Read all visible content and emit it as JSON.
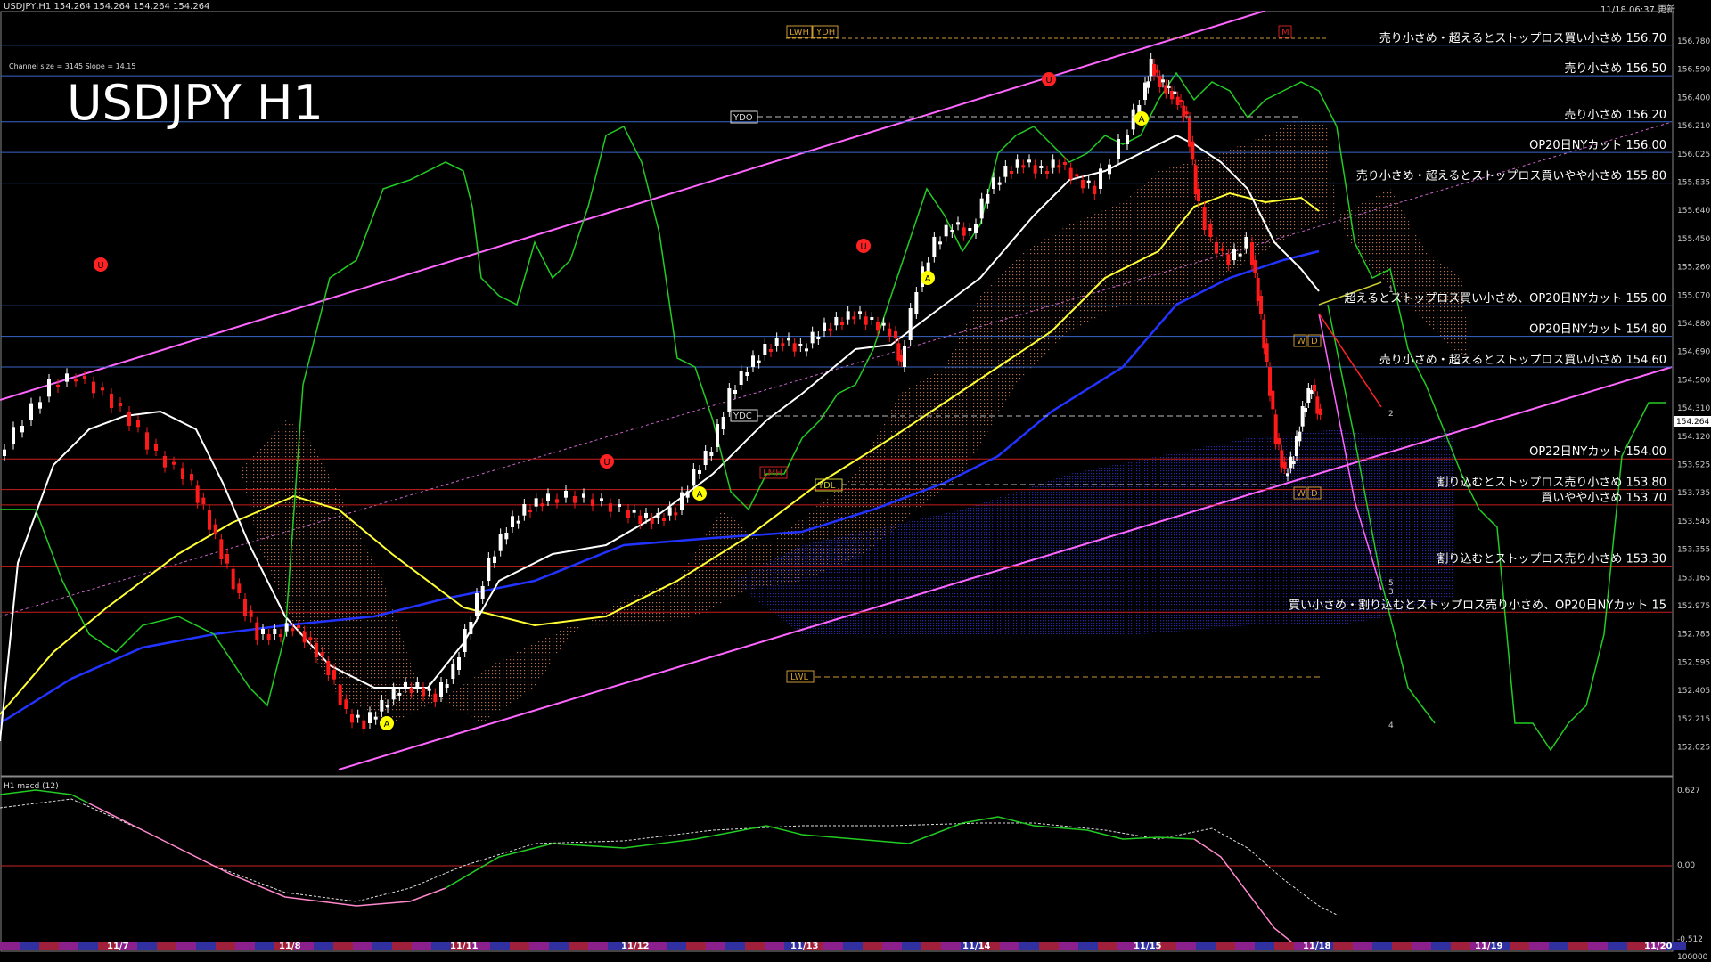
{
  "header": {
    "symbol_info": "USDJPY,H1  154.264 154.264 154.264 154.264",
    "datetime": "11/18 06:37 更新",
    "channel_info": "Channel size = 3145 Slope = 14.15",
    "big_title": "USDJPY H1",
    "macd_label": "H1  macd (12)"
  },
  "price_axis": {
    "ticks": [
      "156.780",
      "156.590",
      "156.400",
      "156.210",
      "156.025",
      "155.835",
      "155.640",
      "155.450",
      "155.260",
      "155.070",
      "154.880",
      "154.690",
      "154.500",
      "154.310",
      "154.120",
      "153.925",
      "153.735",
      "153.545",
      "153.355",
      "153.165",
      "152.975",
      "152.785",
      "152.595",
      "152.405",
      "152.215",
      "152.025"
    ],
    "current_price": "154.264"
  },
  "macd_axis": {
    "ticks": [
      "0.627",
      "0.00",
      "-0.512",
      "100000"
    ]
  },
  "dates": [
    "11/7",
    "11/8",
    "11/11",
    "11/12",
    "11/13",
    "11/14",
    "11/15",
    "11/18",
    "11/19",
    "11/20"
  ],
  "levels": [
    {
      "price": 156.7,
      "color": "#3a66c8",
      "text": "売り小さめ・超えるとストップロス買い小さめ 156.70"
    },
    {
      "price": 156.5,
      "color": "#3a66c8",
      "text": "売り小さめ 156.50"
    },
    {
      "price": 156.2,
      "color": "#3a66c8",
      "text": "売り小さめ 156.20"
    },
    {
      "price": 156.0,
      "color": "#3a66c8",
      "text": "OP20日NYカット 156.00"
    },
    {
      "price": 155.8,
      "color": "#3a66c8",
      "text": "売り小さめ・超えるとストップロス買いやや小さめ 155.80"
    },
    {
      "price": 155.0,
      "color": "#3a66c8",
      "text": "超えるとストップロス買い小さめ、OP20日NYカット 155.00"
    },
    {
      "price": 154.8,
      "color": "#3a66c8",
      "text": "OP20日NYカット 154.80"
    },
    {
      "price": 154.6,
      "color": "#3a66c8",
      "text": "売り小さめ・超えるとストップロス買い小さめ 154.60"
    },
    {
      "price": 154.0,
      "color": "#c81e1e",
      "text": "OP22日NYカット 154.00"
    },
    {
      "price": 153.8,
      "color": "#c81e1e",
      "text": "割り込むとストップロス売り小さめ 153.80"
    },
    {
      "price": 153.7,
      "color": "#c81e1e",
      "text": "買いやや小さめ 153.70"
    },
    {
      "price": 153.3,
      "color": "#c81e1e",
      "text": "割り込むとストップロス売り小さめ 153.30"
    },
    {
      "price": 153.0,
      "color": "#c81e1e",
      "text": "買い小さめ・割り込むとストップロス売り小さめ、OP20日NYカット 15"
    }
  ],
  "tags": {
    "lwh": "LWH",
    "ydh": "YDH",
    "ydo": "YDO",
    "ydc": "YDC",
    "lmh": "LMH",
    "ydl": "YDL",
    "lwl": "LWL",
    "w": "W",
    "d": "D",
    "m": "M"
  },
  "wave_labels": [
    "1",
    "2",
    "3",
    "4",
    "5"
  ],
  "colors": {
    "bull": "#ffffff",
    "bear": "#ff1a1a",
    "ema_white": "#ffffff",
    "ema_yellow": "#ffff33",
    "ma_blue": "#2222ff",
    "chikou": "#22cc22",
    "channel": "#ff66ff"
  }
}
